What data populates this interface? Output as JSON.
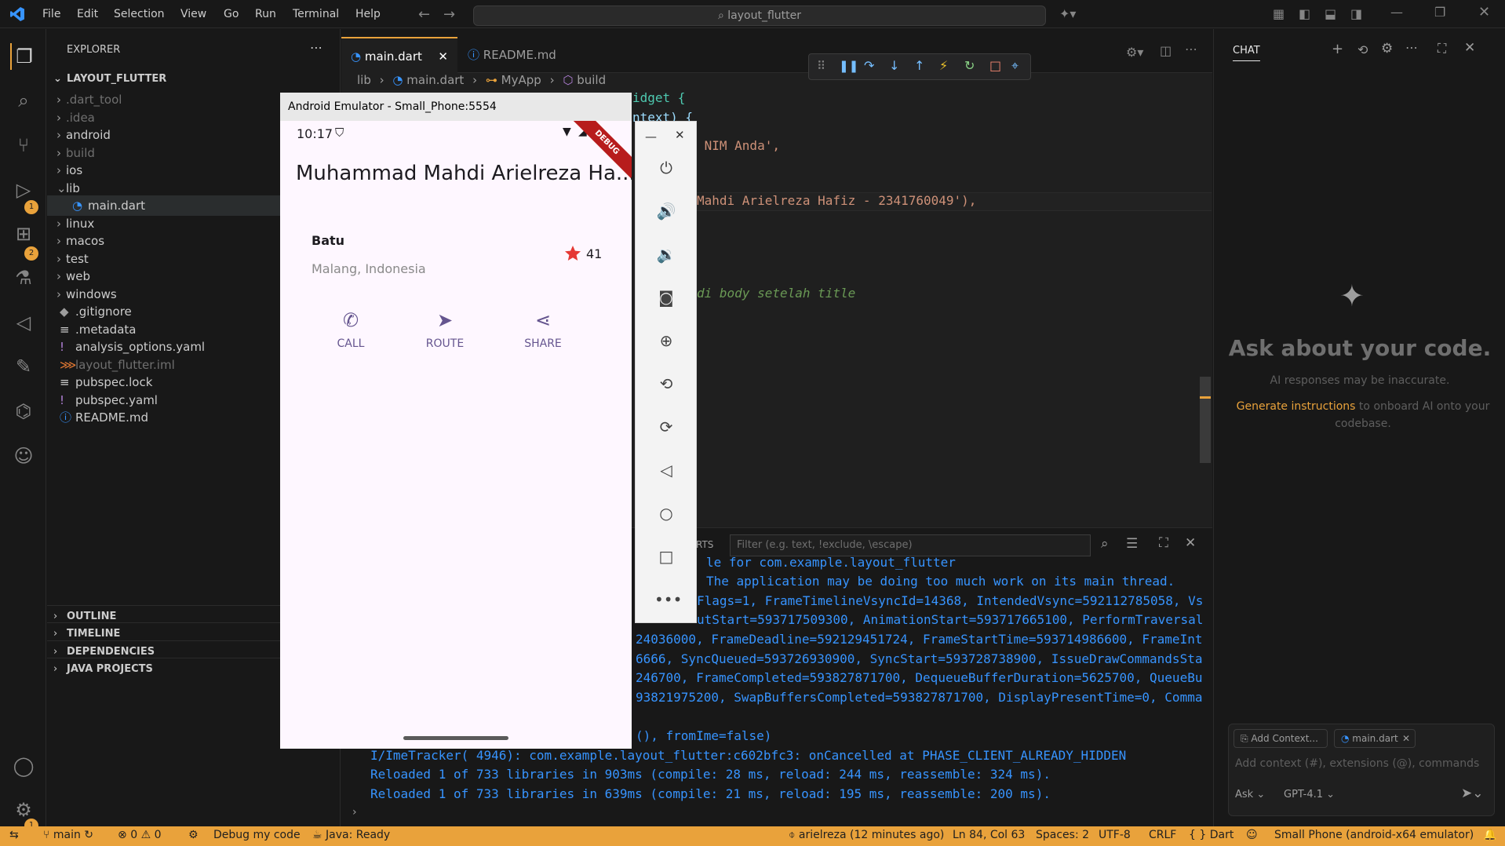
{
  "titlebar": {
    "menu": [
      "File",
      "Edit",
      "Selection",
      "View",
      "Go",
      "Run",
      "Terminal",
      "Help"
    ],
    "search": "layout_flutter"
  },
  "activity": {
    "badges": {
      "run": "1",
      "extensions": "2",
      "settings": "1"
    }
  },
  "explorer": {
    "title": "EXPLORER",
    "root": "LAYOUT_FLUTTER",
    "items": [
      ".dart_tool",
      ".idea",
      "android",
      "build",
      "ios",
      "lib",
      "main.dart",
      "linux",
      "macos",
      "test",
      "web",
      "windows",
      ".gitignore",
      ".metadata",
      "analysis_options.yaml",
      "layout_flutter.iml",
      "pubspec.lock",
      "pubspec.yaml",
      "README.md"
    ],
    "sections": [
      "OUTLINE",
      "TIMELINE",
      "DEPENDENCIES",
      "JAVA PROJECTS"
    ]
  },
  "editor": {
    "tabs": [
      "main.dart",
      "README.md"
    ],
    "breadcrumb": [
      "lib",
      "main.dart",
      "MyApp",
      "build"
    ],
    "code_fragments": [
      "idget {",
      "ntext) {",
      " NIM Anda',",
      "Mahdi Arielreza Hafiz - 2341760049'),",
      "di body setelah title"
    ]
  },
  "panel": {
    "tab_fragment": "RTS",
    "filter_placeholder": "Filter (e.g. text, !exclude, \\escape)",
    "logs": [
      "le for com.example.layout_flutter",
      "The application may be doing too much work on its main thread.",
      "Flags=1, FrameTimelineVsyncId=14368, IntendedVsync=592112785058, Vs",
      "utStart=593717509300, AnimationStart=593717665100, PerformTraversal",
      "24036000, FrameDeadline=592129451724, FrameStartTime=593714986600, FrameInt",
      "6666, SyncQueued=593726930900, SyncStart=593728738900, IssueDrawCommandsSta",
      "246700, FrameCompleted=593827871700, DequeueBufferDuration=5625700, QueueBu",
      "93821975200, SwapBuffersCompleted=593827871700, DisplayPresentTime=0, Comma",
      "(), fromIme=false)",
      "I/ImeTracker( 4946): com.example.layout_flutter:c602bfc3: onCancelled at PHASE_CLIENT_ALREADY_HIDDEN",
      "Reloaded 1 of 733 libraries in 903ms (compile: 28 ms, reload: 244 ms, reassemble: 324 ms).",
      "Reloaded 1 of 733 libraries in 639ms (compile: 21 ms, reload: 195 ms, reassemble: 200 ms)."
    ]
  },
  "chat": {
    "title": "CHAT",
    "heading": "Ask about your code.",
    "disclaimer": "AI responses may be inaccurate.",
    "link": "Generate instructions",
    "link_rest_1": " to onboard AI onto your",
    "link_rest_2": "codebase.",
    "add_context": "Add Context...",
    "file_chip": "main.dart",
    "input_placeholder": "Add context (#), extensions (@), commands",
    "mode": "Ask",
    "model": "GPT-4.1"
  },
  "emulator": {
    "title": "Android Emulator - Small_Phone:5554",
    "time": "10:17",
    "debug": "DEBUG",
    "appbar_title": "Muhammad Mahdi Arielreza Ha...",
    "place_title": "Batu",
    "place_subtitle": "Malang, Indonesia",
    "star_count": "41",
    "buttons": [
      "CALL",
      "ROUTE",
      "SHARE"
    ]
  },
  "statusbar": {
    "branch": "main",
    "errors": "0",
    "warnings": "0",
    "debug": "Debug my code",
    "java": "Java: Ready",
    "blame": "arielreza (12 minutes ago)",
    "position": "Ln 84, Col 63",
    "spaces": "Spaces: 2",
    "encoding": "UTF-8",
    "eol": "CRLF",
    "language": "Dart",
    "device": "Small Phone (android-x64 emulator)"
  },
  "colors": {
    "accent": "#e9a23b",
    "link": "#3794ff",
    "primary": "#65558f",
    "star": "#e53935"
  }
}
